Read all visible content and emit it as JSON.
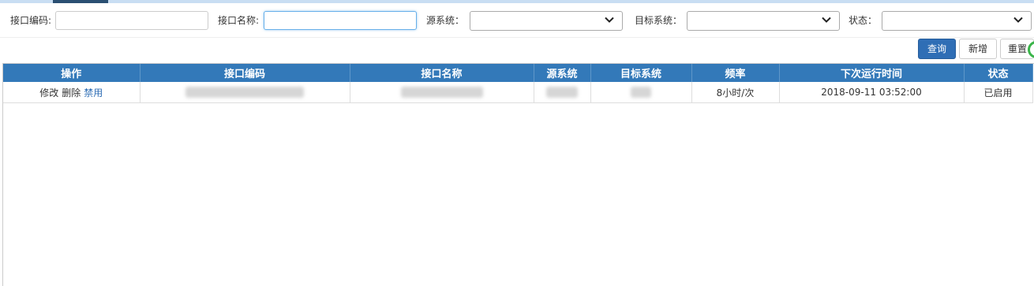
{
  "filters": {
    "code_label": "接口编码:",
    "code_value": "",
    "name_label": "接口名称:",
    "name_value": "",
    "source_label": "源系统：",
    "source_value": "",
    "target_label": "目标系统：",
    "target_value": "",
    "status_label": "状态：",
    "status_value": "",
    "chevron_icon": "chevron-down-icon"
  },
  "buttons": {
    "query": "查询",
    "add": "新增",
    "reset": "重置"
  },
  "table": {
    "headers": [
      "操作",
      "接口编码",
      "接口名称",
      "源系统",
      "目标系统",
      "频率",
      "下次运行时间",
      "状态"
    ],
    "rows": [
      {
        "actions": [
          "修改",
          "删除",
          "禁用"
        ],
        "code": "",
        "name": "",
        "source": "",
        "target": "",
        "frequency": "8小时/次",
        "next_run": "2018-09-11 03:52:00",
        "status": "已启用"
      }
    ]
  },
  "colors": {
    "header_bg": "#3379b9",
    "primary_button": "#2f6eb5",
    "link_blue": "#2f6eb5"
  }
}
